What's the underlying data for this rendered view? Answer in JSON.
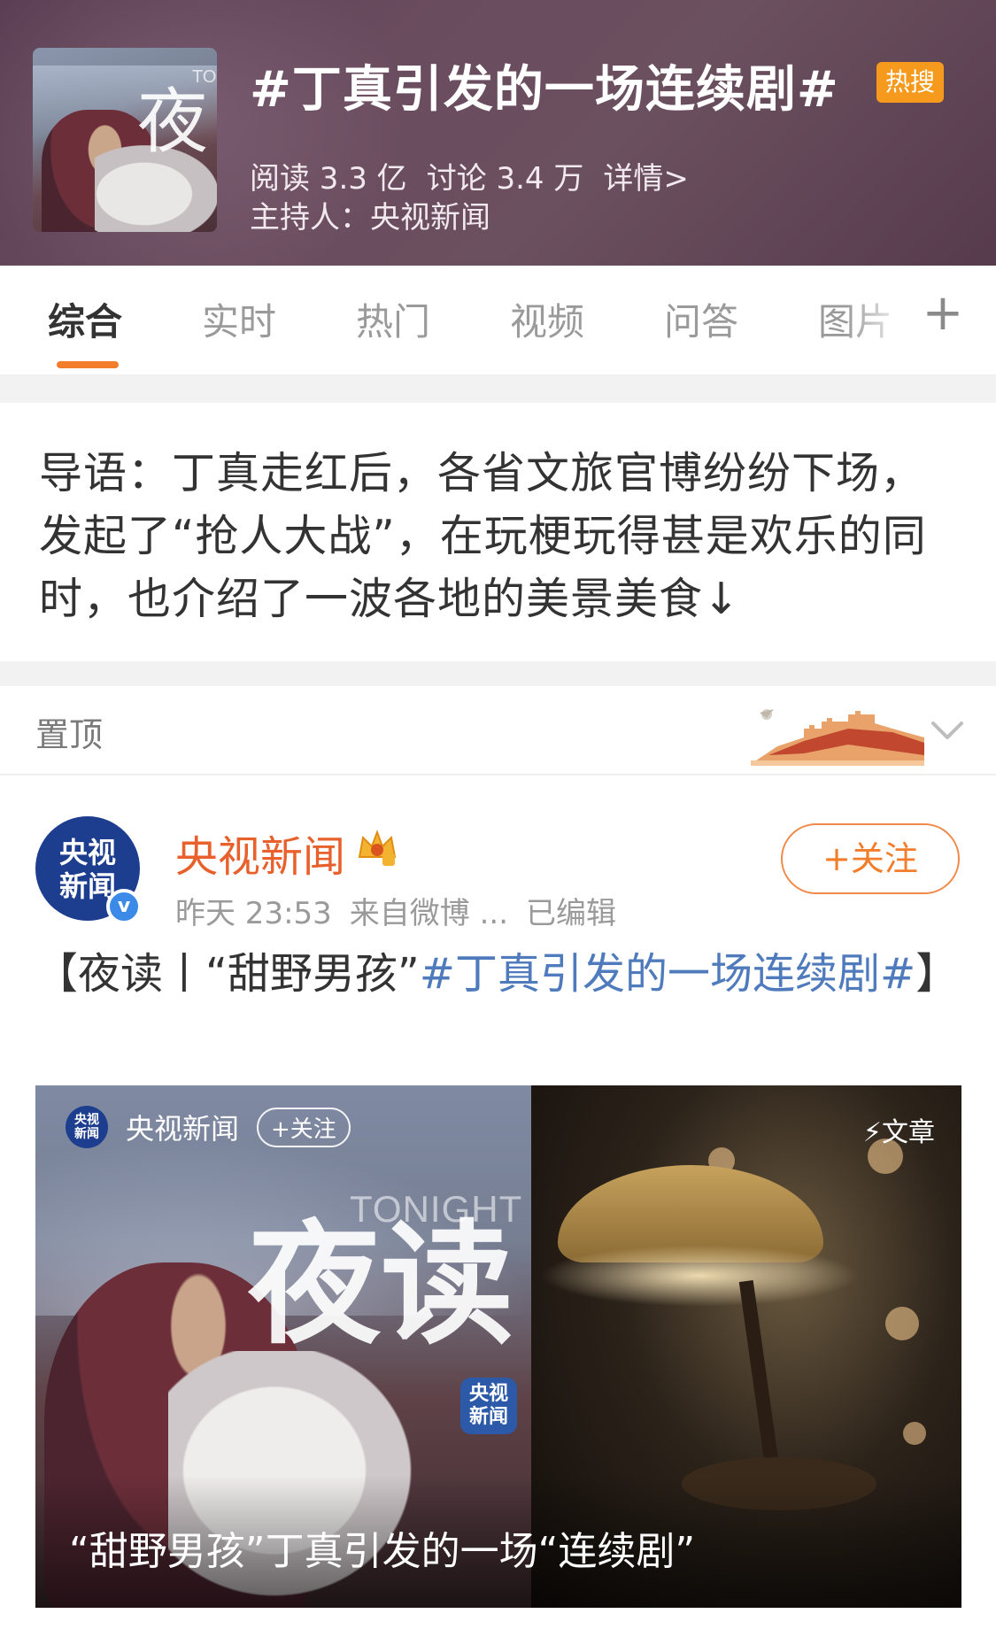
{
  "header": {
    "title": "#丁真引发的一场连续剧#",
    "badge": "热搜",
    "reads": "阅读 3.3 亿",
    "discussions": "讨论 3.4 万",
    "details": "详情>",
    "host": "主持人：央视新闻",
    "thumb_glyph": "夜",
    "thumb_tag": "TO"
  },
  "tabs": [
    {
      "label": "综合",
      "active": true
    },
    {
      "label": "实时"
    },
    {
      "label": "热门"
    },
    {
      "label": "视频"
    },
    {
      "label": "问答"
    },
    {
      "label": "图片"
    }
  ],
  "tabs_more": "+",
  "intro": {
    "text": "导语：丁真走红后，各省文旅官博纷纷下场，发起了“抢人大战”，在玩梗玩得甚是欢乐的同时，也介绍了一波各地的美景美食↓"
  },
  "pinned": {
    "label": "置顶"
  },
  "post": {
    "avatar_line1": "央视",
    "avatar_line2": "新闻",
    "author": "央视新闻",
    "time": "昨天 23:53",
    "source": "来自微博 ...",
    "edited": "已编辑",
    "follow": "+关注",
    "text_prefix": "【夜读丨“甜野男孩”",
    "topic": "#丁真引发的一场连续剧#",
    "text_suffix": "】",
    "card": {
      "name": "央视新闻",
      "follow": "+关注",
      "article": "⚡文章",
      "tonight": "TONIGHT",
      "big_text": "夜读",
      "logo_line1": "央视",
      "logo_line2": "新闻",
      "caption": "“甜野男孩”丁真引发的一场“连续剧”"
    }
  },
  "colors": {
    "accent": "#f27d2b",
    "author_orange": "#e8602c",
    "topic_blue": "#4f7bbd",
    "hot_badge": "#f59a1c"
  }
}
